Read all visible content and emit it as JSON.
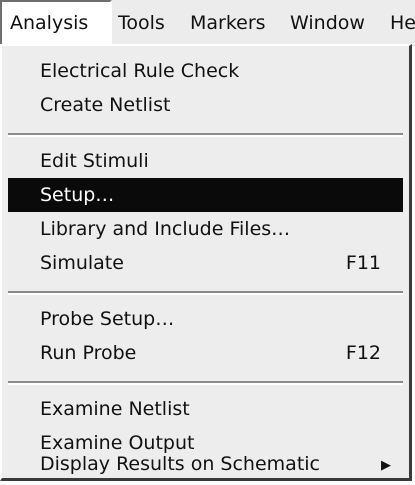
{
  "menubar": {
    "items": [
      {
        "label": "Analysis"
      },
      {
        "label": "Tools"
      },
      {
        "label": "Markers"
      },
      {
        "label": "Window"
      },
      {
        "label": "He"
      }
    ]
  },
  "menu": {
    "electrical_rule_check": "Electrical Rule Check",
    "create_netlist": "Create Netlist",
    "edit_stimuli": "Edit Stimuli",
    "setup": "Setup…",
    "library_include": "Library and Include Files…",
    "simulate": "Simulate",
    "simulate_shortcut": "F11",
    "probe_setup": "Probe Setup…",
    "run_probe": "Run Probe",
    "run_probe_shortcut": "F12",
    "examine_netlist": "Examine Netlist",
    "examine_output": "Examine Output",
    "display_results": "Display Results on Schematic",
    "submenu_arrow": "▶"
  },
  "colors": {
    "highlight_bg": "#0a0a0a",
    "highlight_fg": "#ffffff",
    "menu_bg": "#ededed"
  }
}
